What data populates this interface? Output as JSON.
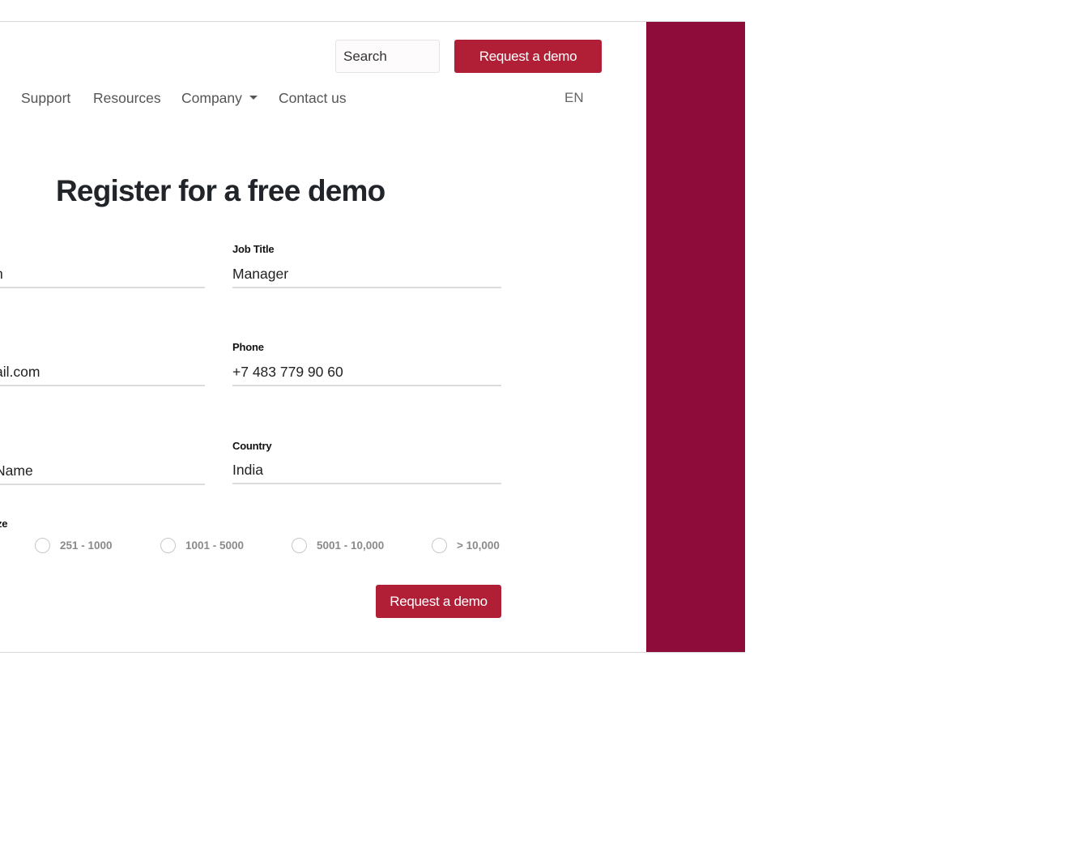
{
  "header": {
    "search_placeholder": "Search",
    "cta_label": "Request a demo",
    "language": "EN"
  },
  "nav": {
    "items": [
      {
        "label": "Support"
      },
      {
        "label": "Resources"
      },
      {
        "label": "Company",
        "has_dropdown": true
      },
      {
        "label": "Contact us"
      }
    ]
  },
  "form": {
    "title": "Register for a free demo",
    "fields": {
      "first_col": {
        "name_value": "h",
        "email_value": "ail.com",
        "company_value": "Name"
      },
      "job_title": {
        "label": "Job Title",
        "value": "Manager"
      },
      "phone": {
        "label": "Phone",
        "value": "+7 483 779 90 60"
      },
      "country": {
        "label": "Country",
        "value": "India"
      }
    },
    "size_label": "ze",
    "size_options": [
      "251 - 1000",
      "1001 - 5000",
      "5001 - 10,000",
      "> 10,000"
    ],
    "submit_label": "Request a demo"
  },
  "colors": {
    "brand_red": "#b01f36",
    "side_panel": "#8e0c3a"
  }
}
